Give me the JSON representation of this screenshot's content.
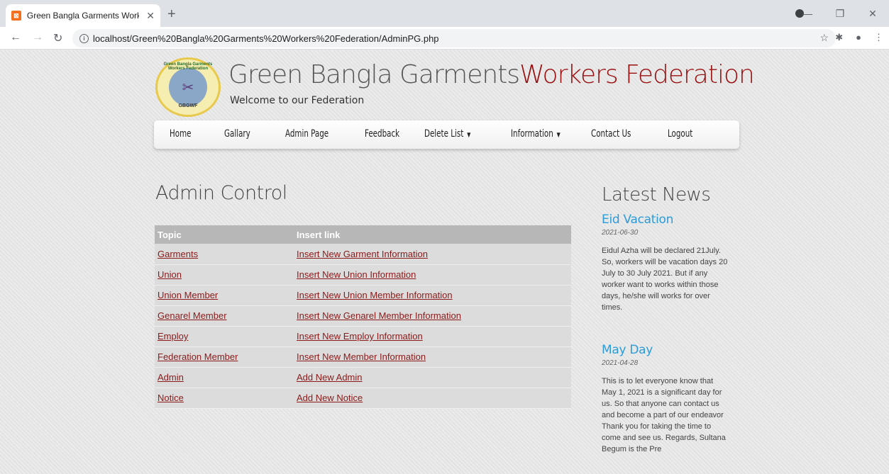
{
  "browser": {
    "tab_title": "Green Bangla Garments Workers",
    "favicon_letter": "⊠",
    "url": "localhost/Green%20Bangla%20Garments%20Workers%20Federation/AdminPG.php"
  },
  "site": {
    "title_part1": "Green Bangla Garments",
    "title_part2": "Workers Federation",
    "tagline": "Welcome to our Federation",
    "logo_ring_text": "Green Bangla Garments Workers Federation",
    "logo_abbr": "GBGWF"
  },
  "menu": [
    {
      "label": "Home"
    },
    {
      "label": "Gallary"
    },
    {
      "label": "Admin Page"
    },
    {
      "label": "Feedback"
    },
    {
      "label": "Delete List",
      "dropdown": true
    },
    {
      "label": "Information",
      "dropdown": true
    },
    {
      "label": "Contact Us"
    },
    {
      "label": "Logout"
    }
  ],
  "admin": {
    "heading": "Admin Control",
    "columns": [
      "Topic",
      "Insert link"
    ],
    "rows": [
      {
        "topic": "Garments",
        "link": "Insert New Garment Information"
      },
      {
        "topic": "Union",
        "link": "Insert New Union Information"
      },
      {
        "topic": "Union Member",
        "link": "Insert New Union Member Information"
      },
      {
        "topic": "Genarel Member",
        "link": "Insert New Genarel Member Information"
      },
      {
        "topic": "Employ",
        "link": "Insert New Employ Information"
      },
      {
        "topic": "Federation Member",
        "link": "Insert New Member Information"
      },
      {
        "topic": "Admin",
        "link": "Add New Admin"
      },
      {
        "topic": "Notice",
        "link": "Add New Notice"
      }
    ]
  },
  "news": {
    "heading": "Latest News",
    "items": [
      {
        "title": "Eid Vacation",
        "date": "2021-06-30",
        "body": "Eidul Azha will be declared 21July. So, workers will be vacation days 20 July to 30 July 2021. But if any worker want to works within those days, he/she will works for over times."
      },
      {
        "title": "May Day",
        "date": "2021-04-28",
        "body": "This is to let everyone know that May 1, 2021 is a significant day for us. So that anyone can contact us and become a part of our endeavor Thank you for taking the time to come and see us. Regards, Sultana Begum is the Pre"
      }
    ]
  }
}
